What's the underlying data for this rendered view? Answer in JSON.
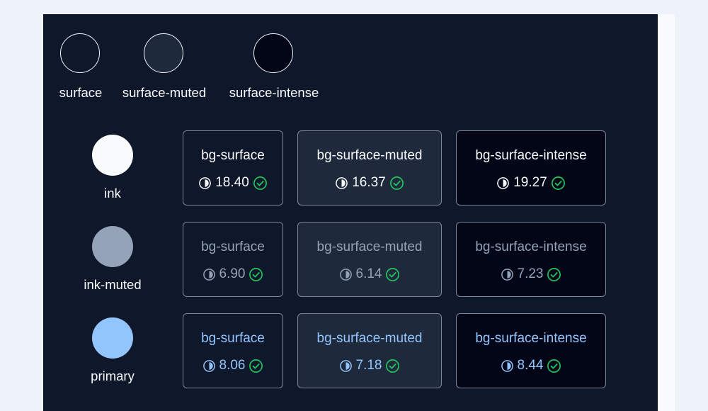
{
  "colors": {
    "surface": "#0f172a",
    "surface_muted": "#1e293b",
    "surface_intense": "#020617",
    "ink": "#f8fafc",
    "ink_muted": "#94a3b8",
    "primary": "#93c5fd",
    "pass": "#22c55e"
  },
  "surfaces": [
    {
      "label": "surface"
    },
    {
      "label": "surface-muted"
    },
    {
      "label": "surface-intense"
    }
  ],
  "rows": [
    {
      "label": "ink",
      "cards": [
        {
          "name": "bg-surface",
          "ratio": "18.40",
          "icon": "contrast-icon",
          "status_icon": "check-circle-icon"
        },
        {
          "name": "bg-surface-muted",
          "ratio": "16.37",
          "icon": "contrast-icon",
          "status_icon": "check-circle-icon"
        },
        {
          "name": "bg-surface-intense",
          "ratio": "19.27",
          "icon": "contrast-icon",
          "status_icon": "check-circle-icon"
        }
      ]
    },
    {
      "label": "ink-muted",
      "cards": [
        {
          "name": "bg-surface",
          "ratio": "6.90",
          "icon": "contrast-icon",
          "status_icon": "check-circle-icon"
        },
        {
          "name": "bg-surface-muted",
          "ratio": "6.14",
          "icon": "contrast-icon",
          "status_icon": "check-circle-icon"
        },
        {
          "name": "bg-surface-intense",
          "ratio": "7.23",
          "icon": "contrast-icon",
          "status_icon": "check-circle-icon"
        }
      ]
    },
    {
      "label": "primary",
      "cards": [
        {
          "name": "bg-surface",
          "ratio": "8.06",
          "icon": "contrast-icon",
          "status_icon": "check-circle-icon"
        },
        {
          "name": "bg-surface-muted",
          "ratio": "7.18",
          "icon": "contrast-icon",
          "status_icon": "check-circle-icon"
        },
        {
          "name": "bg-surface-intense",
          "ratio": "8.44",
          "icon": "contrast-icon",
          "status_icon": "check-circle-icon"
        }
      ]
    }
  ]
}
